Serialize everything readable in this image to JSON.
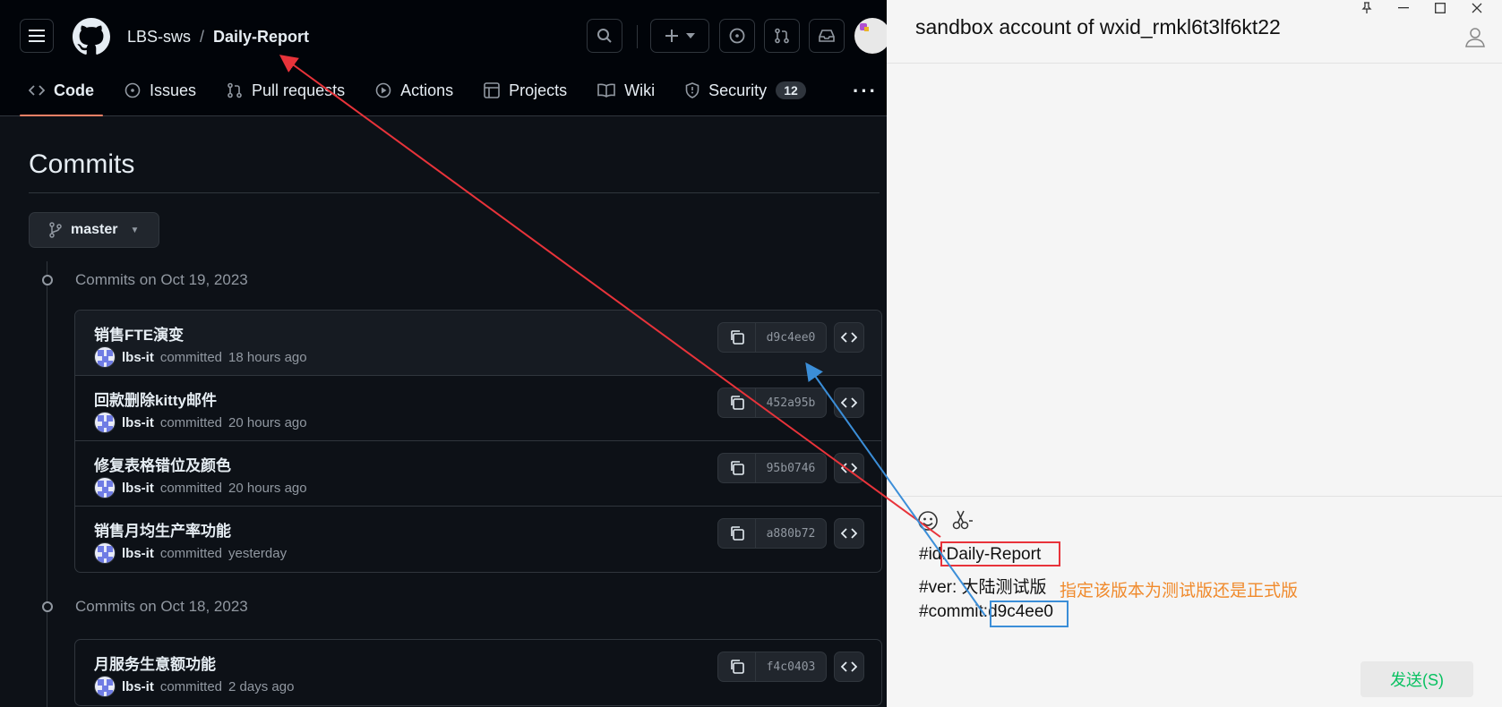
{
  "github": {
    "breadcrumb": {
      "owner": "LBS-sws",
      "separator": "/",
      "repo": "Daily-Report"
    },
    "tabs": [
      {
        "label": "Code",
        "icon": "code-icon",
        "active": true
      },
      {
        "label": "Issues",
        "icon": "issue-opened-icon"
      },
      {
        "label": "Pull requests",
        "icon": "git-pull-request-icon"
      },
      {
        "label": "Actions",
        "icon": "play-icon"
      },
      {
        "label": "Projects",
        "icon": "table-icon"
      },
      {
        "label": "Wiki",
        "icon": "book-icon"
      },
      {
        "label": "Security",
        "icon": "shield-icon",
        "counter": "12"
      }
    ],
    "more": "···",
    "page_title": "Commits",
    "branch": "master",
    "groups": [
      {
        "heading": "Commits on Oct 19, 2023",
        "commits": [
          {
            "message": "销售FTE演变",
            "author": "lbs-it",
            "verb": "committed",
            "time": "18 hours ago",
            "sha": "d9c4ee0"
          },
          {
            "message": "回款删除kitty邮件",
            "author": "lbs-it",
            "verb": "committed",
            "time": "20 hours ago",
            "sha": "452a95b"
          },
          {
            "message": "修复表格错位及颜色",
            "author": "lbs-it",
            "verb": "committed",
            "time": "20 hours ago",
            "sha": "95b0746"
          },
          {
            "message": "销售月均生产率功能",
            "author": "lbs-it",
            "verb": "committed",
            "time": "yesterday",
            "sha": "a880b72"
          }
        ]
      },
      {
        "heading": "Commits on Oct 18, 2023",
        "commits": [
          {
            "message": "月服务生意额功能",
            "author": "lbs-it",
            "verb": "committed",
            "time": "2 days ago",
            "sha": "f4c0403"
          }
        ]
      }
    ]
  },
  "chat": {
    "title": "sandbox account of wxid_rmkl6t3lf6kt22",
    "window_controls": [
      "pin-icon",
      "minimize-icon",
      "maximize-icon",
      "close-icon"
    ],
    "lines": [
      {
        "prefix": "#id:",
        "value": "Daily-Report"
      },
      {
        "prefix": "#ver: ",
        "value": "大陆测试版"
      },
      {
        "prefix": "#commit:",
        "value": "d9c4ee0"
      }
    ],
    "note": "指定该版本为测试版还是正式版",
    "send_label": "发送(S)"
  },
  "colors": {
    "accent_tab": "#f78166",
    "annotation_red": "#e8333a",
    "annotation_blue": "#3b8ed8",
    "note_orange": "#f08a2c",
    "send_green": "#07c160"
  }
}
